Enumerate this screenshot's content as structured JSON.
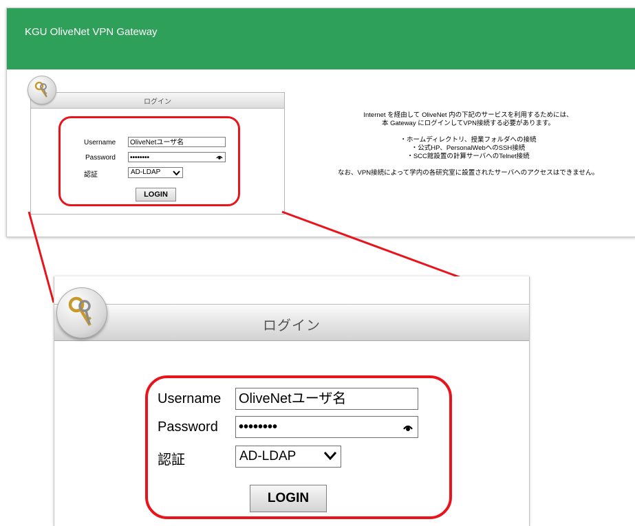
{
  "window": {
    "title": "KGU OliveNet VPN Gateway",
    "colors": {
      "topbar": "#2ea05a",
      "highlight": "#e8131b"
    }
  },
  "login_panel": {
    "title": "ログイン",
    "username_label": "Username",
    "username_value": "OliveNetユーザ名",
    "password_label": "Password",
    "password_value": "••••••••",
    "auth_label": "認証",
    "auth_selected": "AD-LDAP",
    "login_button": "LOGIN"
  },
  "info": {
    "line1": "Internet を経由して OliveNet 内の下記のサービスを利用するためには、",
    "line2": "本 Gateway にログインしてVPN接続する必要があります。",
    "bullet1": "・ホームディレクトリ、授業フォルダへの接続",
    "bullet2": "・公式HP、PersonalWebへのSSH接続",
    "bullet3": "・SCC館設置の計算サーバへのTelnet接続",
    "note": "なお、VPN接続によって学内の各研究室に設置されたサーバへのアクセスはできません。"
  },
  "icons": [
    "keys-icon",
    "eye-icon",
    "chevron-down-icon"
  ]
}
